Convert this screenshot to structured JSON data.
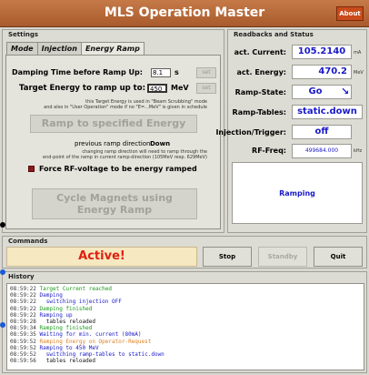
{
  "window": {
    "title": "MLS Operation Master",
    "about_label": "About"
  },
  "settings": {
    "group_label": "Settings",
    "tabs": [
      {
        "label": "Mode",
        "active": false
      },
      {
        "label": "Injection",
        "active": false
      },
      {
        "label": "Energy Ramp",
        "active": true
      }
    ],
    "damping_label": "Damping Time before Ramp Up:",
    "damping_value": "8.1",
    "damping_unit": "s",
    "target_label": "Target Energy to ramp up to:",
    "target_value": "450",
    "target_unit": "MeV",
    "set_label": "set",
    "target_note_1": "this Target Energy is used in \"Beam Scrubbing\" mode",
    "target_note_2": "and also in \"User Operation\" mode if no \"E=...MeV\" is given in schedule",
    "ramp_button": "Ramp to specified Energy",
    "prev_direction_label": "previous ramp direction:",
    "prev_direction_value": "Down",
    "direction_note_1": "changing ramp direction will need to ramp through the",
    "direction_note_2": "end-point of the ramp in current ramp-direction (105MeV resp. 629MeV)",
    "force_rf_label": "Force RF-voltage to be energy ramped",
    "cycle_button_1": "Cycle Magnets using",
    "cycle_button_2": "Energy Ramp"
  },
  "readbacks": {
    "group_label": "Readbacks and Status",
    "current_label": "act. Current:",
    "current_value": "105.2140",
    "current_unit": "mA",
    "energy_label": "act. Energy:",
    "energy_value": "470.2",
    "energy_unit": "MeV",
    "ramp_state_label": "Ramp-State:",
    "ramp_state_value": "Go",
    "ramp_tables_label": "Ramp-Tables:",
    "ramp_tables_value": "static.down",
    "injection_label": "Injection/Trigger:",
    "injection_value": "off",
    "rf_label": "RF-Freq:",
    "rf_value": "499684.000",
    "rf_unit": "kHz",
    "status_text": "Ramping"
  },
  "commands": {
    "group_label": "Commands",
    "active_text": "Active!",
    "stop_label": "Stop",
    "standby_label": "Standby",
    "quit_label": "Quit"
  },
  "history": {
    "group_label": "History",
    "lines": [
      {
        "time": "08:59:22",
        "text": "Target Current reached",
        "color": "#1a9a1a"
      },
      {
        "time": "08:59:22",
        "text": "Damping",
        "color": "#1a1ac8"
      },
      {
        "time": "08:59:22",
        "text": "  switching injection OFF",
        "color": "#1a1ac8"
      },
      {
        "time": "08:59:22",
        "text": "Damping finished",
        "color": "#1a9a1a"
      },
      {
        "time": "08:59:22",
        "text": "Ramping up",
        "color": "#1a1ac8"
      },
      {
        "time": "08:59:28",
        "text": "  tables reloaded",
        "color": "#111111"
      },
      {
        "time": "08:59:34",
        "text": "Ramping finished",
        "color": "#1a9a1a"
      },
      {
        "time": "08:59:35",
        "text": "Waiting for min. current (80mA)",
        "color": "#1a1ac8"
      },
      {
        "time": "08:59:52",
        "text": "Ramping Energy on Operator-Request",
        "color": "#e08020"
      },
      {
        "time": "08:59:52",
        "text": "Ramping to 450 MeV",
        "color": "#1a1ac8"
      },
      {
        "time": "08:59:52",
        "text": "  switching ramp-tables to static.down",
        "color": "#1a1ac8"
      },
      {
        "time": "08:59:56",
        "text": "  tables reloaded",
        "color": "#111111"
      }
    ]
  },
  "colors": {
    "title_bar": "#b86a3a",
    "value_blue": "#1a1ac8",
    "active_red": "#e02010",
    "active_bg": "#f6e8c0"
  }
}
